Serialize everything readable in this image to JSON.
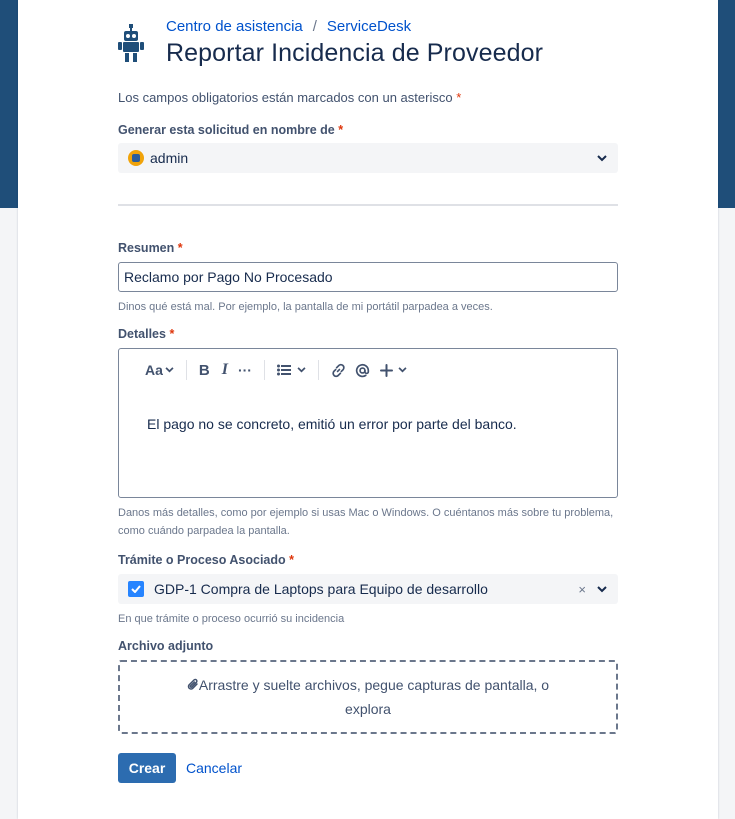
{
  "breadcrumb": {
    "home": "Centro de asistencia",
    "sep": "/",
    "project": "ServiceDesk"
  },
  "page": {
    "title": "Reportar Incidencia de Proveedor"
  },
  "required_note": {
    "text": "Los campos obligatorios están marcados con un asterisco",
    "star": "*"
  },
  "on_behalf": {
    "label": "Generar esta solicitud en nombre de",
    "star": "*",
    "value": "admin"
  },
  "summary": {
    "label": "Resumen",
    "star": "*",
    "value": "Reclamo por Pago No Procesado",
    "help": "Dinos qué está mal. Por ejemplo, la pantalla de mi portátil parpadea a veces."
  },
  "details": {
    "label": "Detalles",
    "star": "*",
    "toolbar": {
      "text_style": "Aa",
      "bold": "B",
      "italic": "I",
      "more": "···"
    },
    "value": "El pago no se concreto, emitió un error por parte del banco.",
    "help_line1": "Danos más detalles, como por ejemplo si usas Mac o Windows. O cuéntanos más sobre tu problema,",
    "help_line2": "como cuándo parpadea la pantalla."
  },
  "process": {
    "label": "Trámite o Proceso Asociado",
    "star": "*",
    "value": "GDP-1 Compra de Laptops para Equipo de desarrollo",
    "clear": "×",
    "help": "En que trámite o proceso ocurrió su incidencia"
  },
  "attachment": {
    "label": "Archivo adjunto",
    "line1": "Arrastre y suelte archivos, pegue capturas de pantalla, o",
    "line2": "explora"
  },
  "actions": {
    "create": "Crear",
    "cancel": "Cancelar"
  },
  "colors": {
    "brand": "#1f4e79",
    "primary_button": "#2c6cb0",
    "link": "#0052cc",
    "required": "#de350b"
  },
  "icons": [
    "robot-icon",
    "avatar",
    "chevron-down-icon",
    "bold-icon",
    "italic-icon",
    "more-icon",
    "bullet-list-icon",
    "link-icon",
    "mention-icon",
    "plus-icon",
    "checkbox-icon",
    "clear-icon",
    "paperclip-icon"
  ]
}
